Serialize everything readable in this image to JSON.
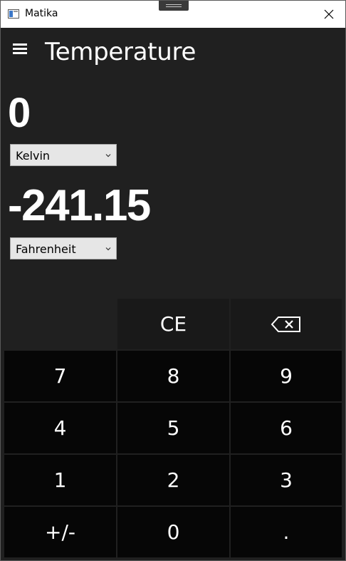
{
  "window": {
    "title": "Matika"
  },
  "header": {
    "menu_icon": "hamburger-icon",
    "title": "Temperature"
  },
  "from": {
    "value": "0",
    "unit": "Kelvin"
  },
  "to": {
    "value": "-241.15",
    "unit": "Fahrenheit"
  },
  "keypad": {
    "ce": "CE",
    "backspace_icon": "backspace-icon",
    "digits": {
      "k7": "7",
      "k8": "8",
      "k9": "9",
      "k4": "4",
      "k5": "5",
      "k6": "6",
      "k1": "1",
      "k2": "2",
      "k3": "3",
      "k0": "0"
    },
    "sign": "+/-",
    "decimal": "."
  },
  "colors": {
    "background": "#202020",
    "key": "#060606",
    "function_key": "#191919",
    "text": "#ffffff",
    "titlebar": "#ffffff"
  }
}
